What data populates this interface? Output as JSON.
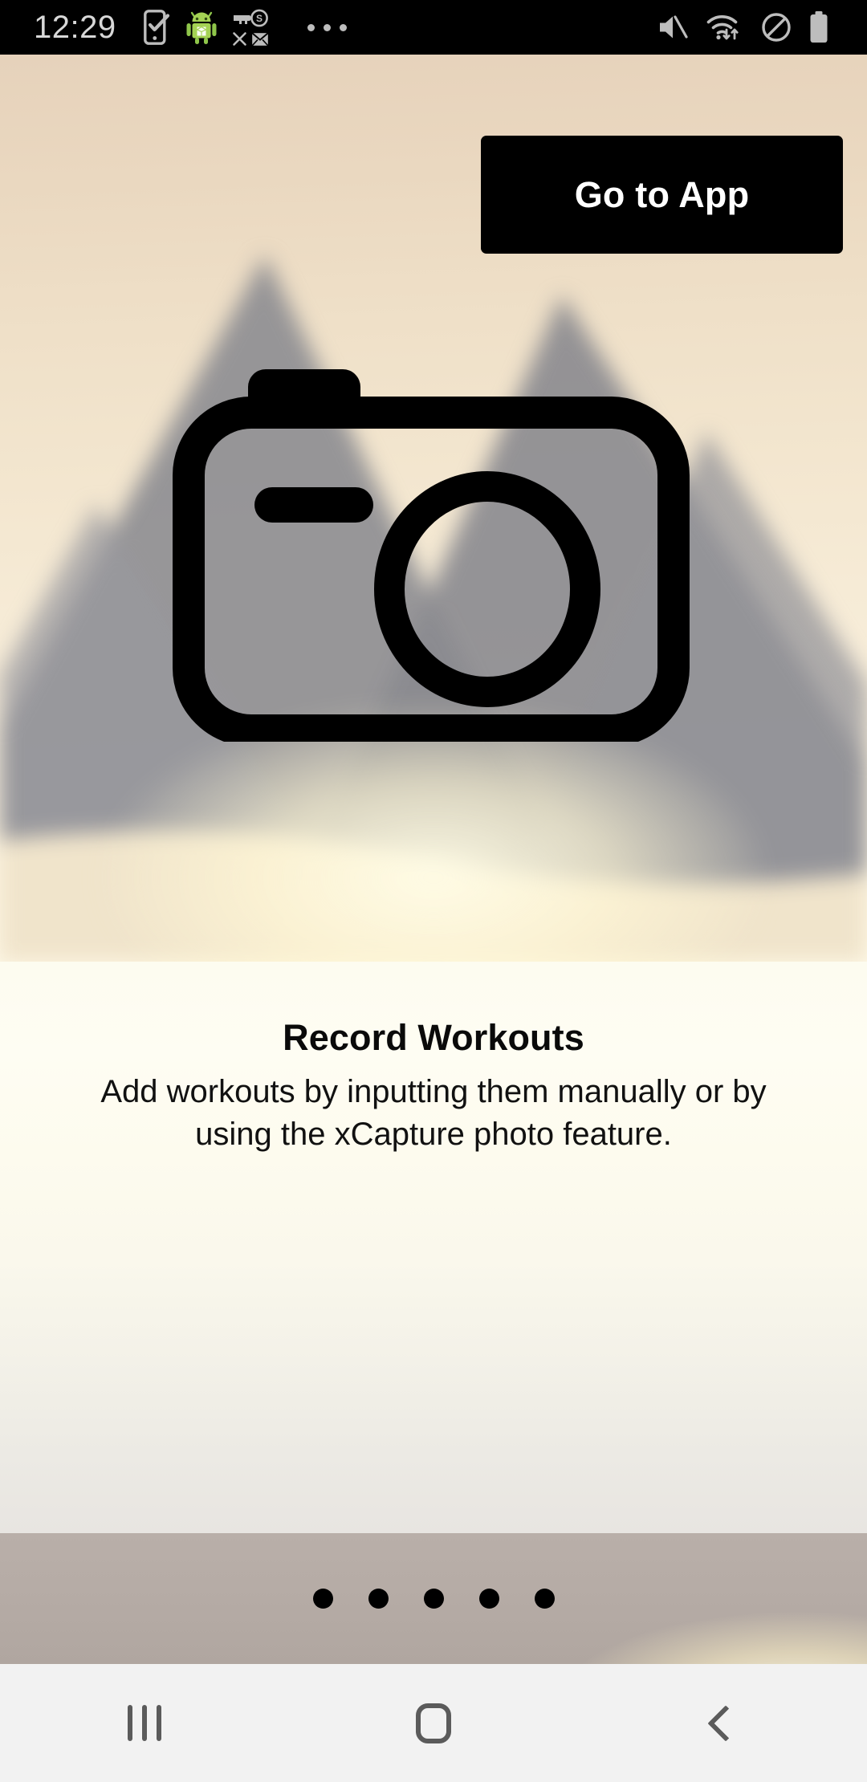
{
  "statusbar": {
    "time": "12:29",
    "left_icons": [
      {
        "name": "phone-checkmark-icon",
        "label": "phone-check"
      },
      {
        "name": "android-robot-icon",
        "label": "android"
      },
      {
        "name": "key-dollar-icon",
        "label": "key-s"
      },
      {
        "name": "close-x-icon",
        "label": "x"
      },
      {
        "name": "envelope-icon",
        "label": "mail"
      },
      {
        "name": "overflow-dots-icon",
        "label": "more notifications"
      }
    ],
    "right_icons": [
      {
        "name": "volume-mute-icon",
        "label": "muted"
      },
      {
        "name": "wifi-transfer-icon",
        "label": "wifi"
      },
      {
        "name": "do-not-disturb-icon",
        "label": "do not disturb"
      },
      {
        "name": "battery-icon",
        "label": "battery full"
      }
    ],
    "colors": {
      "background": "#000000",
      "text": "#d8d8d8",
      "icon": "#bdbdbd"
    }
  },
  "onboarding": {
    "skip_button_label": "Go to App",
    "hero": {
      "illustration": "camera-icon",
      "background": "blurred sunset mountain photo"
    },
    "title": "Record Workouts",
    "description": "Add workouts by inputting them manually or by using the xCapture photo feature.",
    "pager": {
      "total": 5,
      "current": 1,
      "dot_color": "#000000"
    }
  },
  "navbar": {
    "buttons": [
      {
        "name": "recents-button",
        "label": "Recents"
      },
      {
        "name": "home-button",
        "label": "Home"
      },
      {
        "name": "back-button",
        "label": "Back"
      }
    ],
    "colors": {
      "background": "#f2f2f2",
      "icon": "#5b5b5b"
    }
  },
  "theme": {
    "hero_top": "#e6d2bb",
    "hero_bottom": "#fffae9",
    "panel": "#fdfcf0",
    "band": "#b6aca6",
    "button_bg": "#000000",
    "button_text": "#ffffff"
  }
}
